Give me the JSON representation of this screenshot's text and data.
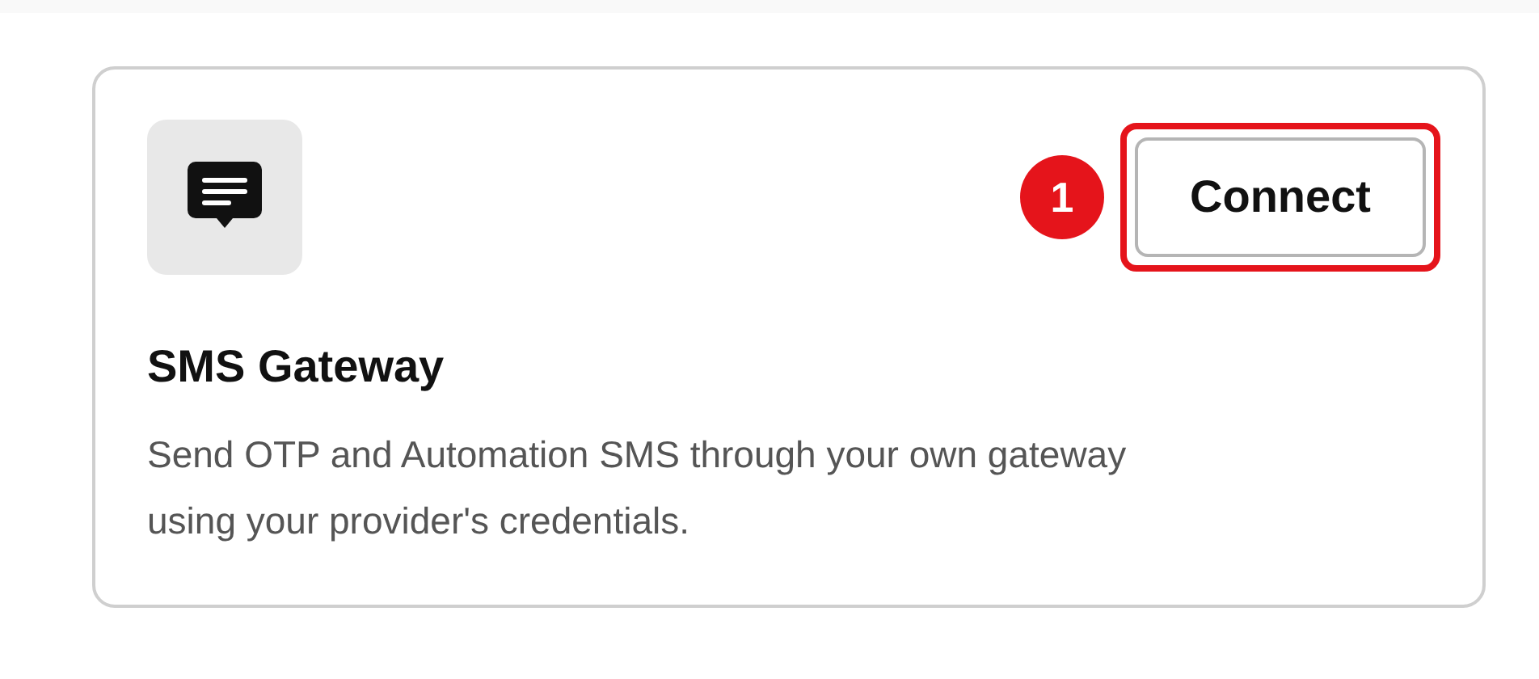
{
  "card": {
    "title": "SMS Gateway",
    "description": "Send OTP and Automation SMS through your own gateway using your provider's credentials.",
    "button": {
      "label": "Connect",
      "highlighted": true
    },
    "step_badge": "1"
  }
}
